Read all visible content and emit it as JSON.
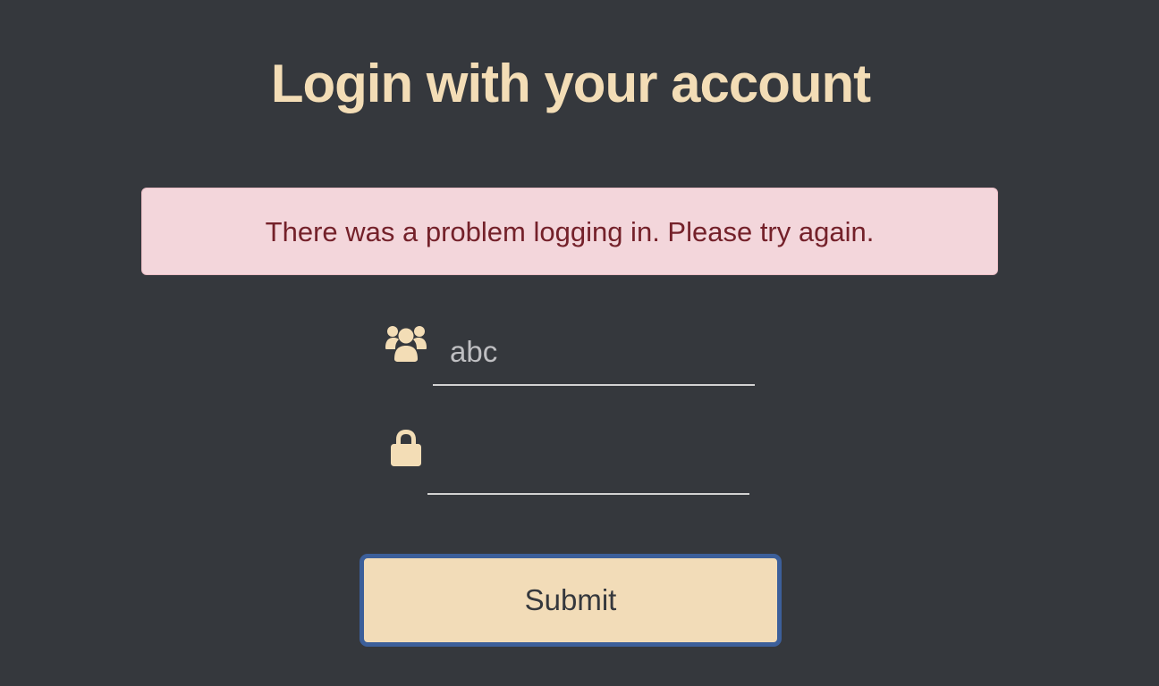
{
  "page": {
    "title": "Login with your account"
  },
  "alert": {
    "message": "There was a problem logging in. Please try again."
  },
  "form": {
    "username": {
      "value": "abc",
      "icon": "users-icon"
    },
    "password": {
      "value": "",
      "icon": "lock-icon"
    },
    "submit_label": "Submit"
  },
  "colors": {
    "background": "#35383d",
    "accent": "#f3ddb6",
    "alert_background": "#f3d6db",
    "alert_text": "#74212a",
    "button_border": "#3c5f9a"
  }
}
